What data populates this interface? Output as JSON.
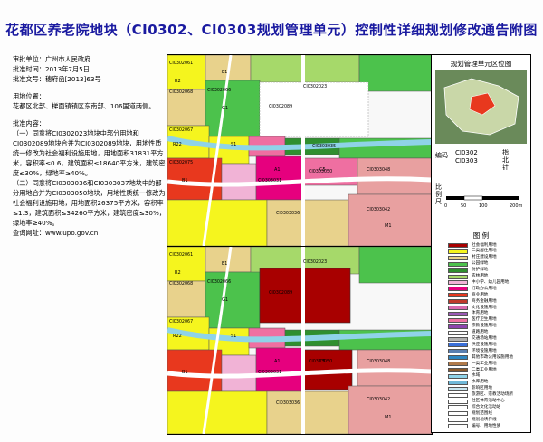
{
  "title": "花都区养老院地块（CI0302、CI0303规划管理单元）控制性详细规划修改通告附图",
  "info": {
    "approver": "审批单位：广州市人民政府",
    "date": "批准时间：2013年7月5日",
    "doc_no": "批准文号：穗府函[2013]63号",
    "location_heading": "用地位置：",
    "location_text": "花都区北部、梯面镇镇区东南部、106国道两侧。",
    "content_heading": "批准内容：",
    "item1": "（一）同意将CI0302023地块中部分用地和CI0302089地块合并为CI0302089地块，用地性质统一修改为社会福利设施用地，用地面积31831平方米，容积率≤0.6，建筑面积≤18640平方米，建筑密度≤30%，绿地率≥40%。",
    "item2": "（二）同意将CI0303036和CI0303037地块中的部分用地合并为CI0303050地块，用地性质统一修改为社会福利设施用地，用地面积26375平方米，容积率≤1.3，建筑面积≤34260平方米，建筑密度≤30%，绿地率≥40%。",
    "query_site": "查询网址：www.upo.gov.cn"
  },
  "side": {
    "locator_title": "规划管理单元区位图",
    "code_label": "编码",
    "codes": [
      "CI0302",
      "CI0303"
    ],
    "north_label": "指北针",
    "scale_label": "比例尺",
    "scale_ticks": [
      "0",
      "50",
      "100",
      "200m"
    ],
    "legend_title": "图 例",
    "legend": [
      {
        "label": "社会福利用地",
        "color": "#a80000"
      },
      {
        "label": "二类居住用地",
        "color": "#f5f51e"
      },
      {
        "label": "村庄建设用地",
        "color": "#e8d28c"
      },
      {
        "label": "公园绿地",
        "color": "#4cc24c"
      },
      {
        "label": "防护绿地",
        "color": "#2f8f2f"
      },
      {
        "label": "农林用地",
        "color": "#a6d96a"
      },
      {
        "label": "中小学、幼儿园用地",
        "color": "#f1b3d6"
      },
      {
        "label": "行政办公用地",
        "color": "#e6007e"
      },
      {
        "label": "商业用地",
        "color": "#e8381e"
      },
      {
        "label": "商务金融用地",
        "color": "#c0392b"
      },
      {
        "label": "文化设施用地",
        "color": "#d96bb0"
      },
      {
        "label": "体育用地",
        "color": "#9b59b6"
      },
      {
        "label": "医疗卫生用地",
        "color": "#ef6fa1"
      },
      {
        "label": "宗教设施用地",
        "color": "#8e44ad"
      },
      {
        "label": "道路用地",
        "color": "#ffffff"
      },
      {
        "label": "交通场站用地",
        "color": "#b0b0b0"
      },
      {
        "label": "供应设施用地",
        "color": "#3a6fd8"
      },
      {
        "label": "环境设施用地",
        "color": "#5a7fb0"
      },
      {
        "label": "其他市政公用设施用地",
        "color": "#2e86c1"
      },
      {
        "label": "一类工业用地",
        "color": "#b07a4a"
      },
      {
        "label": "二类工业用地",
        "color": "#8a5a2c"
      },
      {
        "label": "水域",
        "color": "#8fd3e8"
      },
      {
        "label": "水库用地",
        "color": "#6fb8d8"
      },
      {
        "label": "影响区用地",
        "color": "#c8e6f0"
      },
      {
        "label": "旅游区、宗教活动场所",
        "color": "#ffffff"
      },
      {
        "label": "社区体育活动中心",
        "color": "#ffffff"
      },
      {
        "label": "综合文化活动站",
        "color": "#ffffff"
      },
      {
        "label": "规划范围线",
        "color": "#ffffff"
      },
      {
        "label": "规划地块界线",
        "color": "#ffffff"
      },
      {
        "label": "编号、用地性质",
        "color": "#ffffff"
      }
    ]
  },
  "map_labels": {
    "top": [
      {
        "code": "CI0302061"
      },
      {
        "code": "CI0302068"
      },
      {
        "code": "CI0302066"
      },
      {
        "code": "CI0302067"
      },
      {
        "code": "CI0302075"
      },
      {
        "code": "CI0302089"
      },
      {
        "code": "CI0302023"
      },
      {
        "code": "CI0303035"
      },
      {
        "code": "CI0303050"
      },
      {
        "code": "CI0303048"
      },
      {
        "code": "CI0303042"
      },
      {
        "code": "CI0303036"
      },
      {
        "code": "CI0303031"
      }
    ],
    "bottom": [
      {
        "code": "CI0302061"
      },
      {
        "code": "CI0302068"
      },
      {
        "code": "CI0302066"
      },
      {
        "code": "CI0302067"
      },
      {
        "code": "CI0302023"
      },
      {
        "code": "CI0302089"
      },
      {
        "code": "CI0303050"
      },
      {
        "code": "CI0303048"
      },
      {
        "code": "CI0303042"
      },
      {
        "code": "CI0303036"
      },
      {
        "code": "CI0303031"
      }
    ],
    "landuse_tags": [
      "R2",
      "E1",
      "R22",
      "G1",
      "M1",
      "B1",
      "A1",
      "S1",
      "C5"
    ]
  }
}
